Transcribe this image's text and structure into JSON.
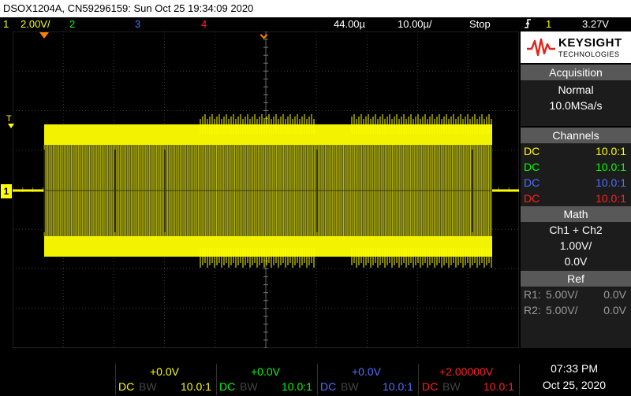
{
  "window": {
    "title": "DSOX1204A, CN59296159: Sun Oct 25 19:34:09 2020"
  },
  "colors": {
    "ch1": "#ffff00",
    "ch2": "#00ff00",
    "ch3": "#4f6fff",
    "ch4": "#ff2020",
    "trigger_marker": "#ff8000"
  },
  "status": {
    "ch1_num": "1",
    "ch1_scale": "2.00V/",
    "ch2_num": "2",
    "ch3_num": "3",
    "ch4_num": "4",
    "delay": "44.00µ",
    "timebase": "10.00µ/",
    "run_state": "Stop",
    "trigger_icon": "trigger-rising-edge-icon",
    "trigger_source": "1",
    "trigger_level": "3.27V"
  },
  "screen": {
    "trigger_label": "T",
    "ground_marker": "1"
  },
  "brand": {
    "name": "KEYSIGHT",
    "sub": "TECHNOLOGIES"
  },
  "acquisition": {
    "header": "Acquisition",
    "mode": "Normal",
    "rate": "10.0MSa/s"
  },
  "channels": {
    "header": "Channels",
    "rows": [
      {
        "coupling": "DC",
        "probe": "10.0:1"
      },
      {
        "coupling": "DC",
        "probe": "10.0:1"
      },
      {
        "coupling": "DC",
        "probe": "10.0:1"
      },
      {
        "coupling": "DC",
        "probe": "10.0:1"
      }
    ]
  },
  "math": {
    "header": "Math",
    "function": "Ch1 + Ch2",
    "scale": "1.00V/",
    "offset": "0.0V"
  },
  "ref": {
    "header": "Ref",
    "rows": [
      {
        "label": "R1:",
        "scale": "5.00V/",
        "offset": "0.0V"
      },
      {
        "label": "R2:",
        "scale": "5.00V/",
        "offset": "0.0V"
      }
    ]
  },
  "bottom": {
    "channels": [
      {
        "offset": "+0.0V",
        "coupling": "DC",
        "bw": "BW",
        "probe": "10.0:1"
      },
      {
        "offset": "+0.0V",
        "coupling": "DC",
        "bw": "BW",
        "probe": "10.0:1"
      },
      {
        "offset": "+0.0V",
        "coupling": "DC",
        "bw": "BW",
        "probe": "10.0:1"
      },
      {
        "offset": "+2.00000V",
        "coupling": "DC",
        "bw": "BW",
        "probe": "10.0:1"
      }
    ],
    "time": "07:33 PM",
    "date": "Oct 25, 2020"
  }
}
